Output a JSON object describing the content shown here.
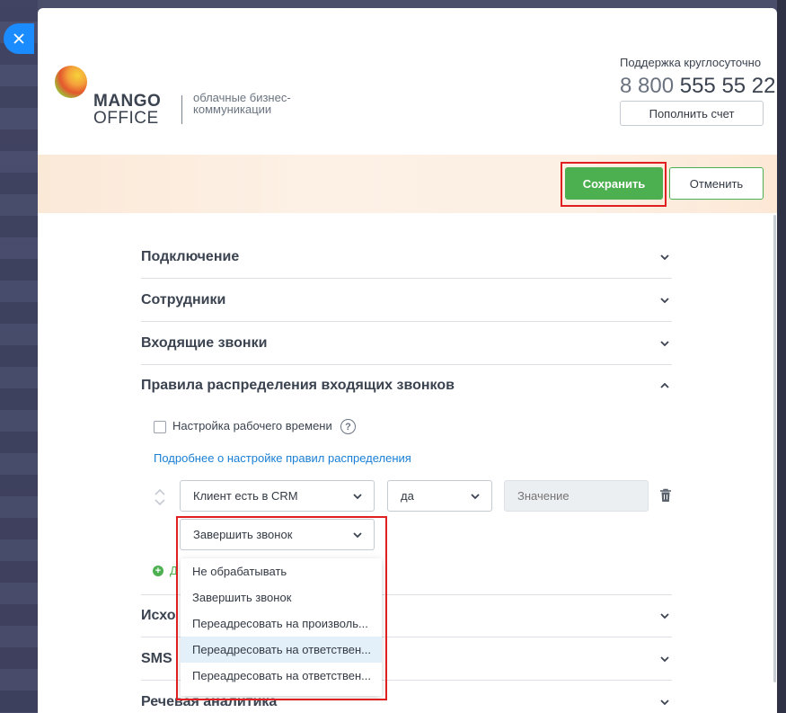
{
  "brand": {
    "name_top": "MANGO",
    "name_bottom": "OFFICE",
    "tagline": "облачные бизнес-коммуникации"
  },
  "support": {
    "label": "Поддержка круглосуточно",
    "phone_prefix": "8 800",
    "phone_number": "555 55 22",
    "topup_button": "Пополнить счет"
  },
  "actions": {
    "save": "Сохранить",
    "cancel": "Отменить"
  },
  "sections": [
    {
      "title": "Подключение",
      "expanded": false
    },
    {
      "title": "Сотрудники",
      "expanded": false
    },
    {
      "title": "Входящие звонки",
      "expanded": false
    },
    {
      "title": "Правила распределения входящих звонков",
      "expanded": true
    },
    {
      "title": "Исходящие звонки",
      "expanded": false,
      "visible_text": "Исхо"
    },
    {
      "title": "SMS",
      "expanded": false
    },
    {
      "title": "Речевая аналитика",
      "expanded": false
    }
  ],
  "rules": {
    "work_time_label": "Настройка рабочего времени",
    "work_time_checked": false,
    "help_icon": "?",
    "more_link": "Подробнее о настройке правил распределения",
    "condition": {
      "field": "Клиент есть в CRM",
      "operator": "да",
      "value_placeholder": "Значение"
    },
    "action_select": "Завершить звонок",
    "add_text": "Д"
  },
  "dropdown": {
    "options": [
      "Не обрабатывать",
      "Завершить звонок",
      "Переадресовать на произволь...",
      "Переадресовать на ответствен...",
      "Переадресовать на ответствен..."
    ],
    "hovered_index": 3
  },
  "colors": {
    "accent_green": "#4caf50",
    "link_blue": "#1a7fd4",
    "highlight_red": "#e02020",
    "close_blue": "#1a8cff"
  }
}
